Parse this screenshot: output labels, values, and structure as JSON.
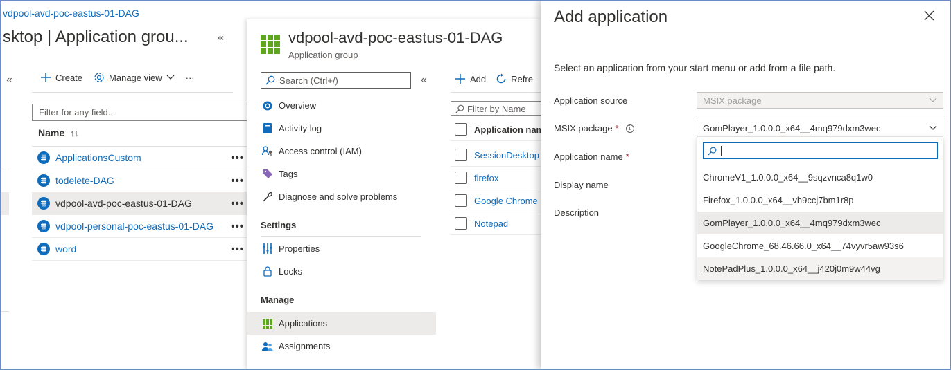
{
  "breadcrumb": {
    "pool": "vdpool-avd-poc-eastus-01-DAG"
  },
  "blade1": {
    "title": "sktop | Application grou...",
    "toolbar": {
      "create": "Create",
      "manage_view": "Manage view",
      "more": "···"
    },
    "filter_placeholder": "Filter for any field...",
    "column_name": "Name",
    "rows": [
      {
        "label": "ApplicationsCustom"
      },
      {
        "label": "todelete-DAG"
      },
      {
        "label": "vdpool-avd-poc-eastus-01-DAG",
        "selected": true
      },
      {
        "label": "vdpool-personal-poc-eastus-01-DAG"
      },
      {
        "label": "word"
      }
    ],
    "row_more": "•••"
  },
  "blade2": {
    "title": "vdpool-avd-poc-eastus-01-DAG",
    "subtitle": "Application group",
    "search_placeholder": "Search (Ctrl+/)",
    "nav": {
      "overview": "Overview",
      "activity_log": "Activity log",
      "access_control": "Access control (IAM)",
      "tags": "Tags",
      "diagnose": "Diagnose and solve problems",
      "settings_header": "Settings",
      "properties": "Properties",
      "locks": "Locks",
      "manage_header": "Manage",
      "applications": "Applications",
      "assignments": "Assignments"
    },
    "toolbar": {
      "add": "Add",
      "refresh": "Refre"
    },
    "filter_placeholder": "Filter by Name",
    "app_column": "Application nam",
    "apps": [
      {
        "label": "SessionDesktop"
      },
      {
        "label": "firefox"
      },
      {
        "label": "Google Chrome"
      },
      {
        "label": "Notepad"
      }
    ]
  },
  "blade3": {
    "title": "Add application",
    "description": "Select an application from your start menu or add from a file path.",
    "fields": {
      "application_source_label": "Application source",
      "application_source_value": "MSIX package",
      "msix_package_label": "MSIX package",
      "msix_package_value": "GomPlayer_1.0.0.0_x64__4mq979dxm3wec",
      "application_name_label": "Application name",
      "display_name_label": "Display name",
      "description_label": "Description",
      "required_mark": "*"
    },
    "dropdown_options": [
      {
        "label": "ChromeV1_1.0.0.0_x64__9sqzvnca8q1w0"
      },
      {
        "label": "Firefox_1.0.0.0_x64__vh9ccj7bm1r8p"
      },
      {
        "label": "GomPlayer_1.0.0.0_x64__4mq979dxm3wec",
        "selected": true
      },
      {
        "label": "GoogleChrome_68.46.66.0_x64__74vyvr5aw93s6"
      },
      {
        "label": "NotePadPlus_1.0.0.0_x64__j420j0m9w44vg",
        "hover": true
      }
    ]
  },
  "colors": {
    "accent": "#0f6cbd",
    "selected_bg": "#edebe9",
    "required": "#a4262c"
  },
  "icons": [
    "app-group-icon",
    "search-icon",
    "plus-icon",
    "gear-icon",
    "chevron-down-icon",
    "refresh-icon",
    "close-icon",
    "info-icon",
    "collapse-icon"
  ]
}
